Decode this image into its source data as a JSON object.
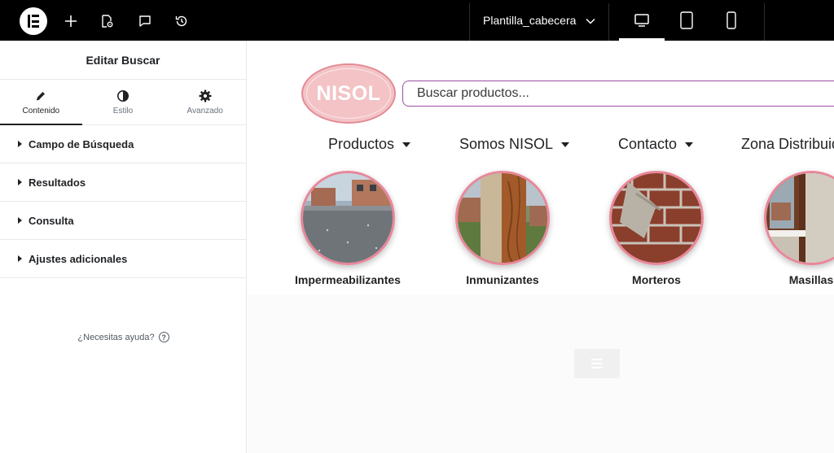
{
  "topbar": {
    "template_name": "Plantilla_cabecera",
    "icons": [
      "elementor-logo-icon",
      "plus-icon",
      "page-settings-icon",
      "comments-icon",
      "history-icon",
      "chevron-down-icon",
      "desktop-icon",
      "tablet-icon",
      "mobile-icon"
    ],
    "active_device": "desktop"
  },
  "panel": {
    "title": "Editar Buscar",
    "tabs": [
      {
        "label": "Contenido",
        "icon": "pencil-icon",
        "active": true
      },
      {
        "label": "Estilo",
        "icon": "half-circle-icon",
        "active": false
      },
      {
        "label": "Avanzado",
        "icon": "gear-icon",
        "active": false
      }
    ],
    "sections": [
      {
        "label": "Campo de Búsqueda"
      },
      {
        "label": "Resultados"
      },
      {
        "label": "Consulta"
      },
      {
        "label": "Ajustes adicionales"
      }
    ],
    "help_text": "¿Necesitas ayuda?",
    "help_icon_glyph": "?"
  },
  "preview": {
    "logo_text": "NISOL",
    "search_placeholder": "Buscar productos...",
    "menu": [
      {
        "label": "Productos"
      },
      {
        "label": "Somos NISOL"
      },
      {
        "label": "Contacto"
      },
      {
        "label": "Zona Distribuidores"
      }
    ],
    "categories": [
      {
        "label": "Impermeabilizantes"
      },
      {
        "label": "Inmunizantes"
      },
      {
        "label": "Morteros"
      },
      {
        "label": "Masillas"
      }
    ]
  },
  "colors": {
    "topbar_bg": "#000000",
    "logo_pink": "#f3c3c6",
    "circle_border": "#e9879a",
    "search_border": "#9a4fa0"
  }
}
